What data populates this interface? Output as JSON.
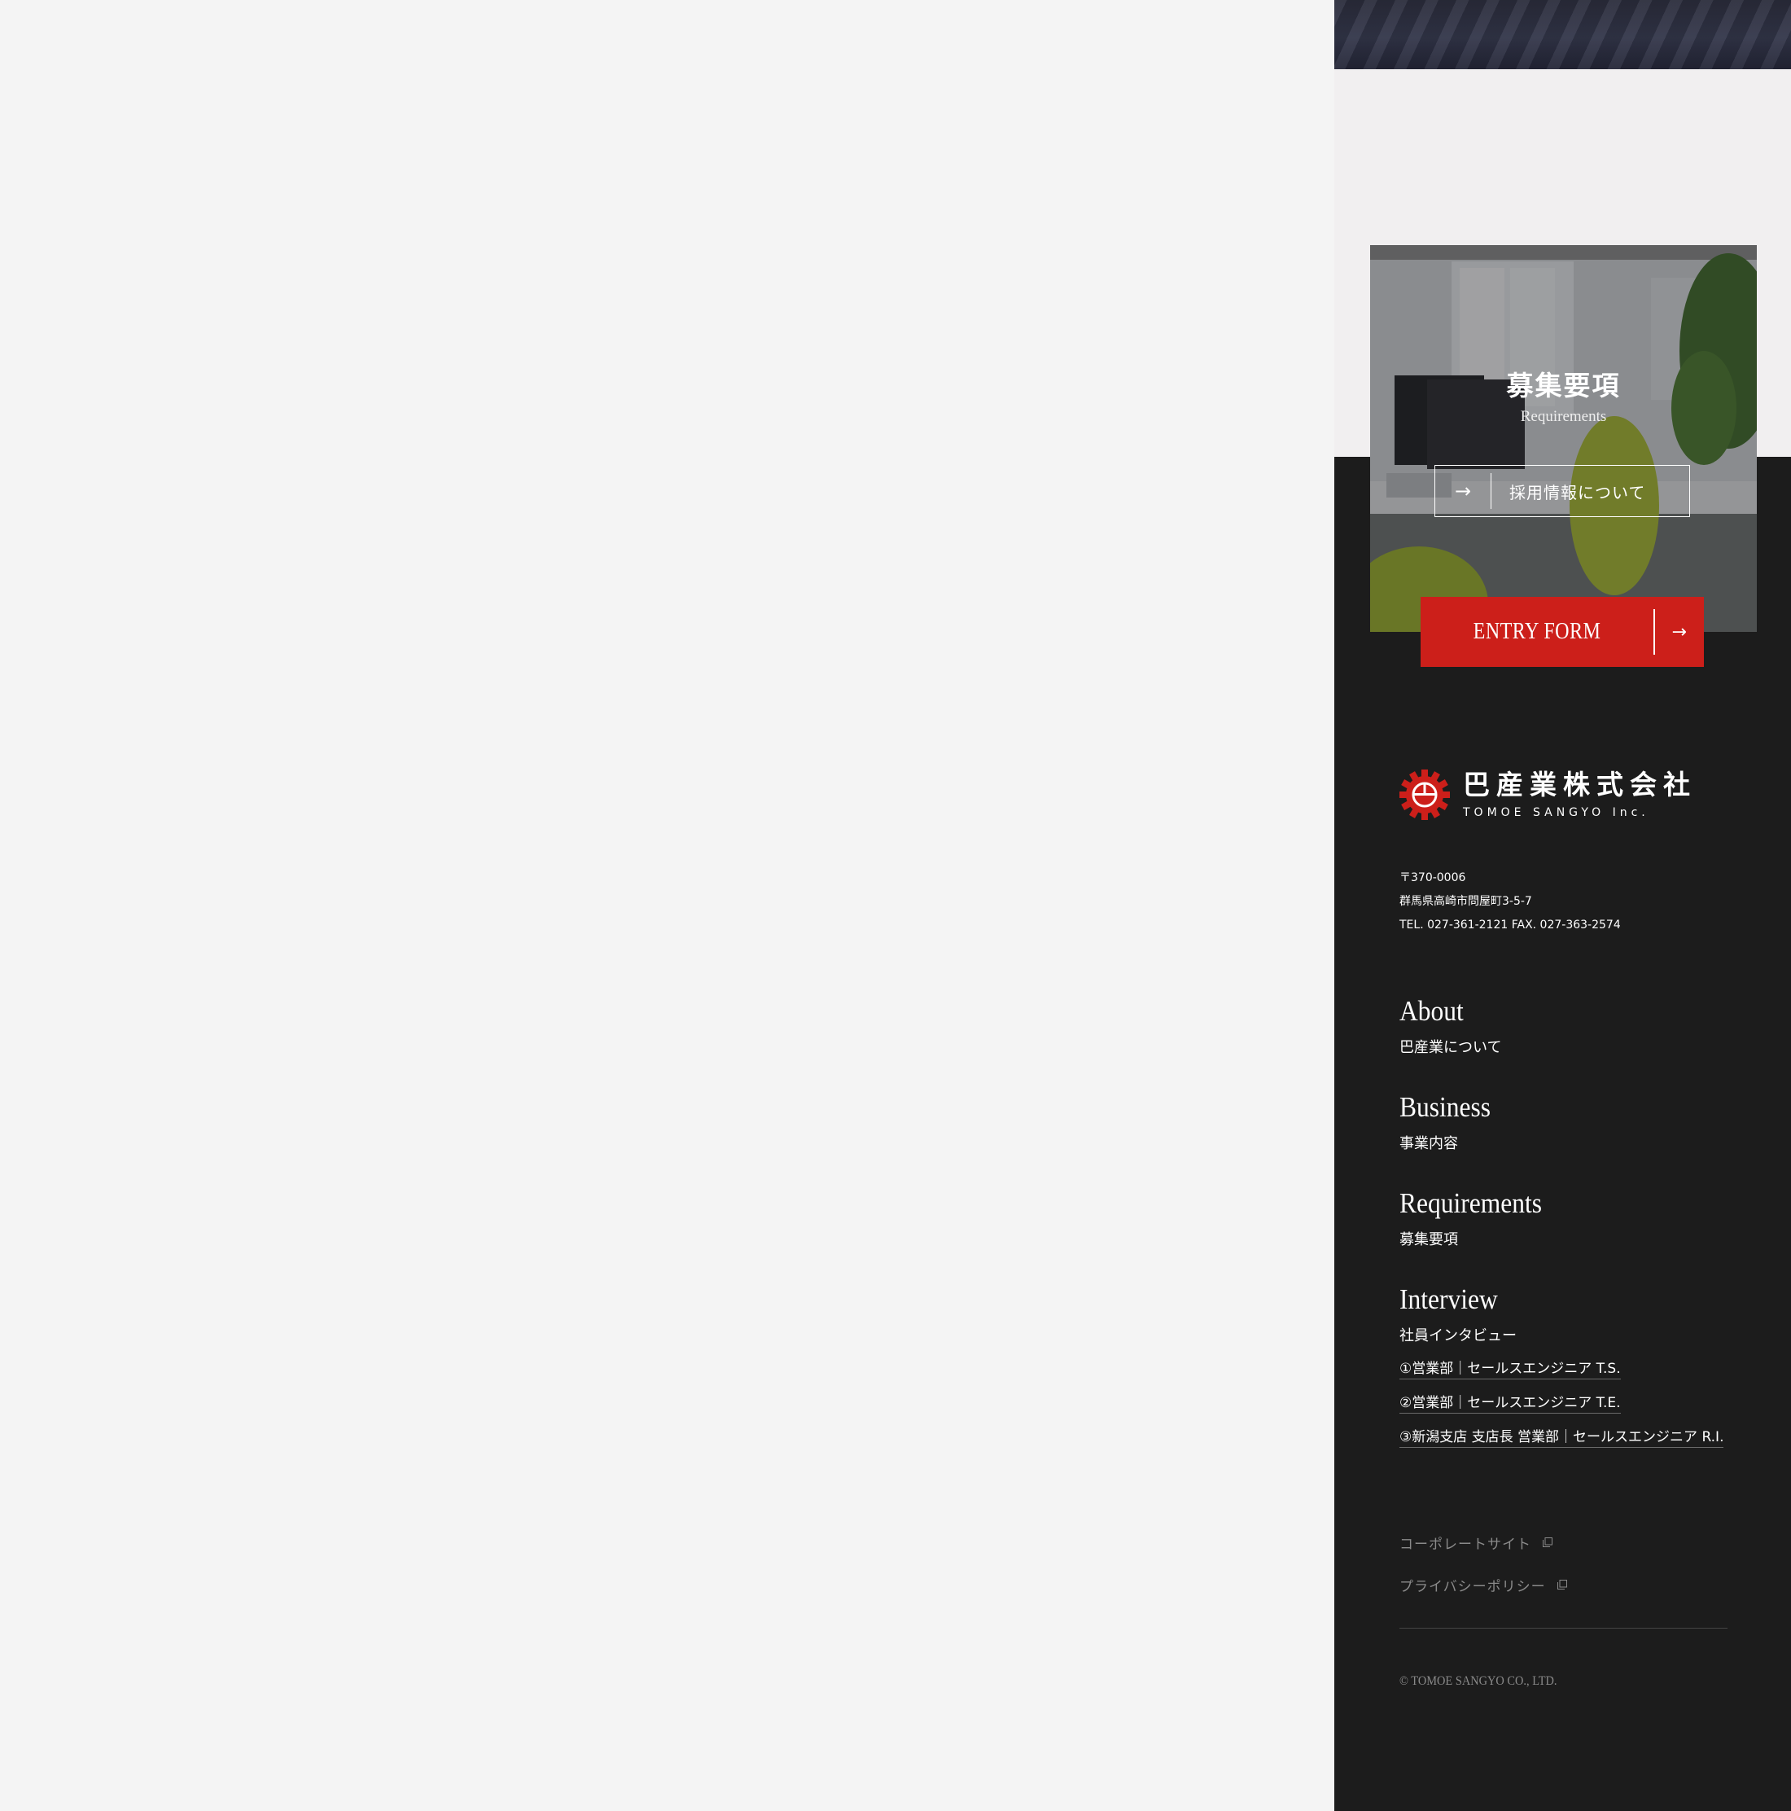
{
  "requirements_card": {
    "title": "募集要項",
    "subtitle": "Requirements",
    "button_label": "採用情報について"
  },
  "entry": {
    "label": "ENTRY FORM"
  },
  "company": {
    "name_jp": "巴産業株式会社",
    "name_en": "TOMOE SANGYO Inc.",
    "postal": "〒370-0006",
    "address": "群馬県高崎市問屋町3-5-7",
    "contact": "TEL. 027-361-2121 FAX. 027-363-2574"
  },
  "nav": {
    "about": {
      "en": "About",
      "jp": "巴産業について"
    },
    "business": {
      "en": "Business",
      "jp": "事業内容"
    },
    "requirements": {
      "en": "Requirements",
      "jp": "募集要項"
    },
    "interview": {
      "en": "Interview",
      "jp": "社員インタビュー",
      "items": [
        "①営業部｜セールスエンジニア T.S.",
        "②営業部｜セールスエンジニア T.E.",
        "③新潟支店 支店長 営業部｜セールスエンジニア R.I."
      ]
    }
  },
  "external_links": {
    "corporate": "コーポレートサイト",
    "privacy": "プライバシーポリシー"
  },
  "copyright": "© TOMOE SANGYO CO., LTD.",
  "colors": {
    "accent": "#cc1f1a",
    "dark": "#1c1c1c",
    "light": "#f1eff0",
    "page": "#f4f4f4"
  }
}
